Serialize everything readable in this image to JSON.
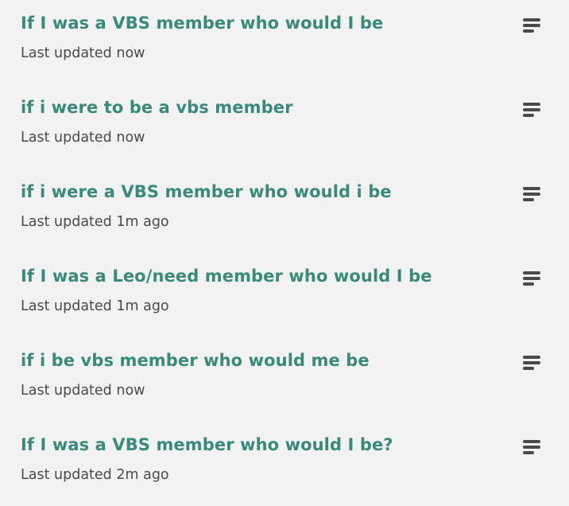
{
  "items": [
    {
      "title": "If I was a VBS member who would I be",
      "subtitle": "Last updated now",
      "menu_icon": "sort-lines-icon"
    },
    {
      "title": "if i were to be a vbs member",
      "subtitle": "Last updated now",
      "menu_icon": "sort-lines-icon"
    },
    {
      "title": "if i were a VBS member who would i be",
      "subtitle": "Last updated 1m ago",
      "menu_icon": "sort-lines-icon"
    },
    {
      "title": "If I was a Leo/need member who would I be",
      "subtitle": "Last updated 1m ago",
      "menu_icon": "sort-lines-icon"
    },
    {
      "title": "if i be vbs member who would me be",
      "subtitle": "Last updated now",
      "menu_icon": "sort-lines-icon"
    },
    {
      "title": "If I was a VBS member who would I be?",
      "subtitle": "Last updated 2m ago",
      "menu_icon": "sort-lines-icon"
    }
  ],
  "colors": {
    "background": "#f2f2f2",
    "title": "#3a8a7c",
    "subtitle": "#4a4a4a",
    "icon": "#4a4a4a"
  }
}
